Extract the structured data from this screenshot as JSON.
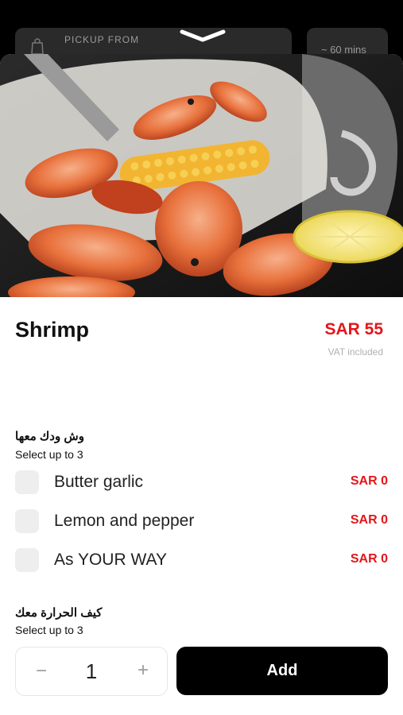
{
  "header": {
    "pickup_label": "PICKUP FROM",
    "time_label": "~ 60 mins"
  },
  "item": {
    "name": "Shrimp",
    "price": "SAR 55",
    "vat_note": "VAT included"
  },
  "groups": [
    {
      "title": "وش ودك معها",
      "subtitle": "Select up to 3",
      "options": [
        {
          "label": "Butter garlic",
          "price": "SAR 0"
        },
        {
          "label": "Lemon and pepper",
          "price": "SAR 0"
        },
        {
          "label": "As YOUR WAY",
          "price": "SAR 0"
        }
      ]
    },
    {
      "title": "كيف الحرارة معك",
      "subtitle": "Select up to 3"
    }
  ],
  "footer": {
    "quantity": "1",
    "minus_symbol": "−",
    "plus_symbol": "+",
    "add_label": "Add"
  },
  "colors": {
    "accent": "#e3161b",
    "button": "#000000",
    "checkbox": "#eeeeee"
  }
}
